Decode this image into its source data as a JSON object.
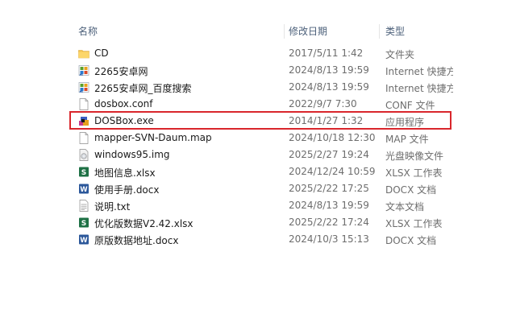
{
  "columns": {
    "name": "名称",
    "date": "修改日期",
    "type": "类型"
  },
  "colors": {
    "folder": "#f5c451",
    "highlight": "#d9262c",
    "excel": "#1e7145",
    "word": "#2b579a"
  },
  "files": [
    {
      "name": "CD",
      "date": "2017/5/11 1:42",
      "type": "文件夹",
      "icon": "folder-icon"
    },
    {
      "name": "2265安卓网",
      "date": "2024/8/13 19:59",
      "type": "Internet 快捷方式",
      "icon": "internet-shortcut-icon"
    },
    {
      "name": "2265安卓网_百度搜索",
      "date": "2024/8/13 19:59",
      "type": "Internet 快捷方式",
      "icon": "internet-shortcut-icon"
    },
    {
      "name": "dosbox.conf",
      "date": "2022/9/7 7:30",
      "type": "CONF 文件",
      "icon": "blank-file-icon"
    },
    {
      "name": "DOSBox.exe",
      "date": "2014/1/27 1:32",
      "type": "应用程序",
      "icon": "dosbox-app-icon"
    },
    {
      "name": "mapper-SVN-Daum.map",
      "date": "2024/10/18 12:30",
      "type": "MAP 文件",
      "icon": "blank-file-icon"
    },
    {
      "name": "windows95.img",
      "date": "2025/2/27 19:24",
      "type": "光盘映像文件",
      "icon": "disc-image-icon"
    },
    {
      "name": "地图信息.xlsx",
      "date": "2024/12/24 10:59",
      "type": "XLSX 工作表",
      "icon": "excel-icon"
    },
    {
      "name": "使用手册.docx",
      "date": "2025/2/22 17:25",
      "type": "DOCX 文档",
      "icon": "word-icon"
    },
    {
      "name": "说明.txt",
      "date": "2024/8/13 19:59",
      "type": "文本文档",
      "icon": "text-file-icon"
    },
    {
      "name": "优化版数据V2.42.xlsx",
      "date": "2025/2/22 17:24",
      "type": "XLSX 工作表",
      "icon": "excel-icon"
    },
    {
      "name": "原版数据地址.docx",
      "date": "2024/10/3 15:13",
      "type": "DOCX 文档",
      "icon": "word-icon"
    }
  ]
}
